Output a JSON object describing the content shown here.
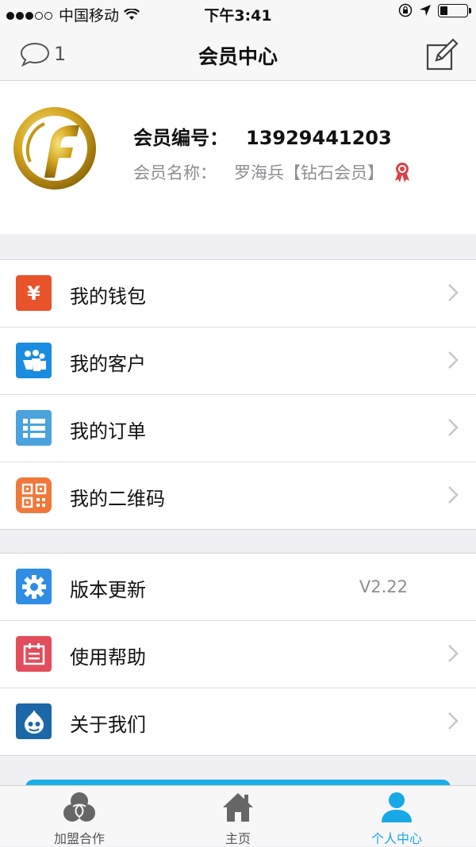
{
  "status_bar": {
    "carrier": "中国移动",
    "time": "下午3:41"
  },
  "nav": {
    "title": "会员中心",
    "message_count": "1"
  },
  "profile": {
    "member_id_label": "会员编号：",
    "member_id": "13929441203",
    "member_name_label": "会员名称：",
    "member_name": "罗海兵【钻石会员】"
  },
  "menu_group_1": [
    {
      "label": "我的钱包",
      "icon": "wallet-icon",
      "icon_text": "¥",
      "color": "#e9532b"
    },
    {
      "label": "我的客户",
      "icon": "customers-icon",
      "color": "#1a8de0"
    },
    {
      "label": "我的订单",
      "icon": "orders-icon",
      "color": "#4aa3dc"
    },
    {
      "label": "我的二维码",
      "icon": "qrcode-icon",
      "color": "#f0793a"
    }
  ],
  "menu_group_2": [
    {
      "label": "版本更新",
      "icon": "update-gear-icon",
      "value": "V2.22",
      "color": "#2f8de4"
    },
    {
      "label": "使用帮助",
      "icon": "help-calendar-icon",
      "color": "#e24d5c"
    },
    {
      "label": "关于我们",
      "icon": "about-drupal-icon",
      "color": "#1c67a8"
    }
  ],
  "tabs": [
    {
      "label": "加盟合作",
      "icon": "partnership-icon"
    },
    {
      "label": "主页",
      "icon": "home-icon"
    },
    {
      "label": "个人中心",
      "icon": "profile-icon",
      "active": true
    }
  ],
  "colors": {
    "accent": "#19a8e6",
    "background": "#efeff4"
  }
}
